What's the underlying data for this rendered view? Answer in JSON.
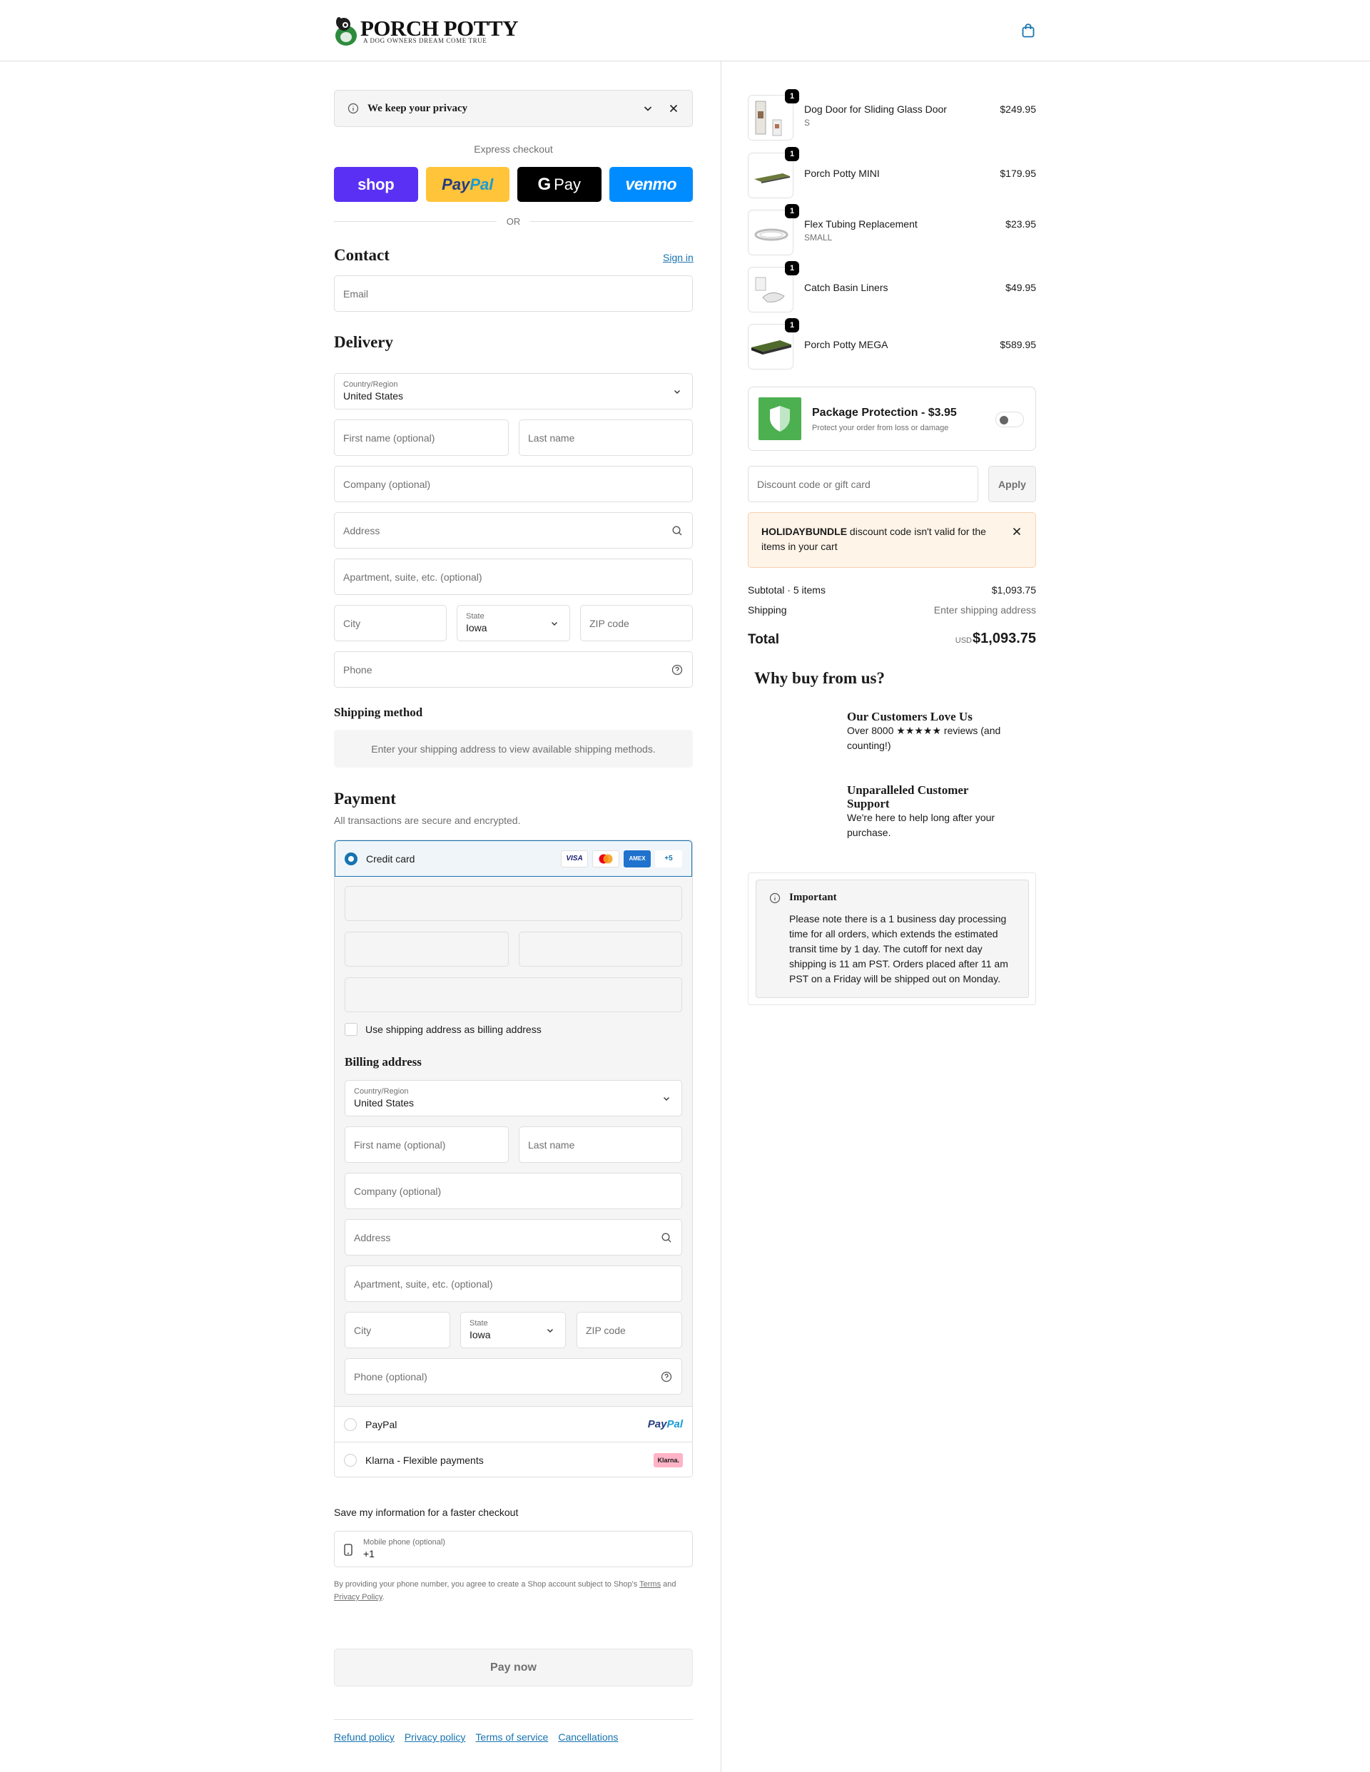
{
  "brand": {
    "name": "PORCH POTTY",
    "tagline": "A DOG OWNERS DREAM COME TRUE"
  },
  "colors": {
    "accent": "#1773b0",
    "shop": "#5a31f4",
    "paypal": "#ffc439",
    "venmo": "#008cff",
    "warning_bg": "#fff4e8",
    "protect_green": "#4caf50"
  },
  "privacy": {
    "label": "We keep your privacy"
  },
  "express": {
    "label": "Express checkout",
    "shop": "shop",
    "paypal_pay": "Pay",
    "paypal_pal": "Pal",
    "gpay": "Pay",
    "venmo": "venmo",
    "or": "OR"
  },
  "contact": {
    "title": "Contact",
    "sign_in": "Sign in",
    "email_placeholder": "Email"
  },
  "delivery": {
    "title": "Delivery",
    "country_label": "Country/Region",
    "country_value": "United States",
    "first_name": "First name (optional)",
    "last_name": "Last name",
    "company": "Company (optional)",
    "address": "Address",
    "apartment": "Apartment, suite, etc. (optional)",
    "city": "City",
    "state_label": "State",
    "state_value": "Iowa",
    "zip": "ZIP code",
    "phone": "Phone"
  },
  "shipping_method": {
    "title": "Shipping method",
    "info": "Enter your shipping address to view available shipping methods."
  },
  "payment": {
    "title": "Payment",
    "subtitle": "All transactions are secure and encrypted.",
    "credit_card": "Credit card",
    "cards": [
      "VISA",
      "MC",
      "AMEX",
      "+5"
    ],
    "use_shipping": "Use shipping address as billing address",
    "billing_title": "Billing address",
    "billing": {
      "country_label": "Country/Region",
      "country_value": "United States",
      "first_name": "First name (optional)",
      "last_name": "Last name",
      "company": "Company (optional)",
      "address": "Address",
      "apartment": "Apartment, suite, etc. (optional)",
      "city": "City",
      "state_label": "State",
      "state_value": "Iowa",
      "zip": "ZIP code",
      "phone": "Phone (optional)"
    },
    "paypal": "PayPal",
    "paypal_logo_pay": "Pay",
    "paypal_logo_pal": "Pal",
    "klarna": "Klarna - Flexible payments",
    "klarna_logo": "Klarna."
  },
  "save_info": {
    "label": "Save my information for a faster checkout",
    "mobile_label": "Mobile phone (optional)",
    "mobile_value": "+1",
    "legal_pre": "By providing your phone number, you agree to create a Shop account subject to Shop's ",
    "terms": "Terms",
    "legal_and": " and ",
    "privacy_policy": "Privacy Policy",
    "legal_end": "."
  },
  "pay_now": "Pay now",
  "footer_links": [
    "Refund policy",
    "Privacy policy",
    "Terms of service",
    "Cancellations"
  ],
  "cart": {
    "items": [
      {
        "name": "Dog Door for Sliding Glass Door",
        "variant": "S",
        "qty": "1",
        "price": "$249.95"
      },
      {
        "name": "Porch Potty MINI",
        "variant": "",
        "qty": "1",
        "price": "$179.95"
      },
      {
        "name": "Flex Tubing Replacement",
        "variant": "SMALL",
        "qty": "1",
        "price": "$23.95"
      },
      {
        "name": "Catch Basin Liners",
        "variant": "",
        "qty": "1",
        "price": "$49.95"
      },
      {
        "name": "Porch Potty MEGA",
        "variant": "",
        "qty": "1",
        "price": "$589.95"
      }
    ],
    "protection": {
      "title": "Package Protection - $3.95",
      "subtitle": "Protect your order from loss or damage"
    },
    "discount_placeholder": "Discount code or gift card",
    "apply": "Apply",
    "warning_code": "HOLIDAYBUNDLE",
    "warning_text": " discount code isn't valid for the items in your cart",
    "subtotal_label": "Subtotal · 5 items",
    "subtotal_value": "$1,093.75",
    "shipping_label": "Shipping",
    "shipping_value": "Enter shipping address",
    "total_label": "Total",
    "currency": "USD",
    "total_value": "$1,093.75"
  },
  "why": {
    "title": "Why buy from us?",
    "items": [
      {
        "title": "Our Customers Love Us",
        "desc": "Over 8000 ★★★★★ reviews (and counting!)"
      },
      {
        "title": "Unparalleled Customer Support",
        "desc": "We're here to help long after your purchase."
      }
    ]
  },
  "important": {
    "title": "Important",
    "text": "Please note there is a 1 business day processing time for all orders, which extends the estimated transit time by 1 day. The cutoff for next day shipping is 11 am PST. Orders placed after 11 am PST on a Friday will be shipped out on Monday."
  }
}
